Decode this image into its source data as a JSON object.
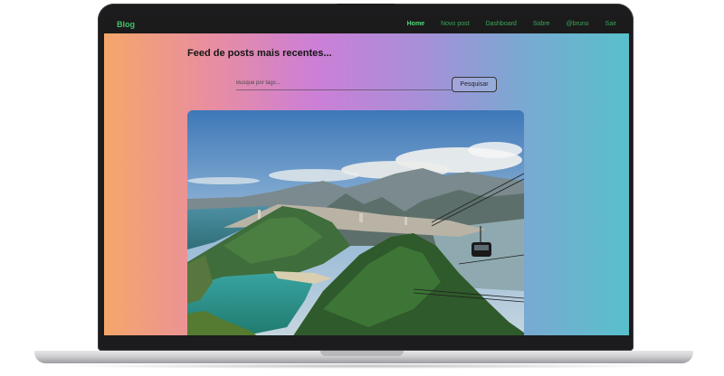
{
  "navbar": {
    "brand": "Blog",
    "links": [
      {
        "label": "Home",
        "active": true
      },
      {
        "label": "Novo post"
      },
      {
        "label": "Dashboard"
      },
      {
        "label": "Sobre"
      },
      {
        "label": "@bruno"
      },
      {
        "label": "Sair"
      }
    ]
  },
  "feed": {
    "title": "Feed de posts mais recentes...",
    "search_placeholder": "Busque por tags...",
    "search_button": "Pesquisar"
  },
  "colors": {
    "brand_green": "#3dc46a",
    "navbar_bg": "#1b1b1b",
    "gradient": [
      "#f5a66a",
      "#cc7fd6",
      "#58c0cb"
    ]
  },
  "post": {
    "image_subject": "Rio de Janeiro cable car photo"
  }
}
